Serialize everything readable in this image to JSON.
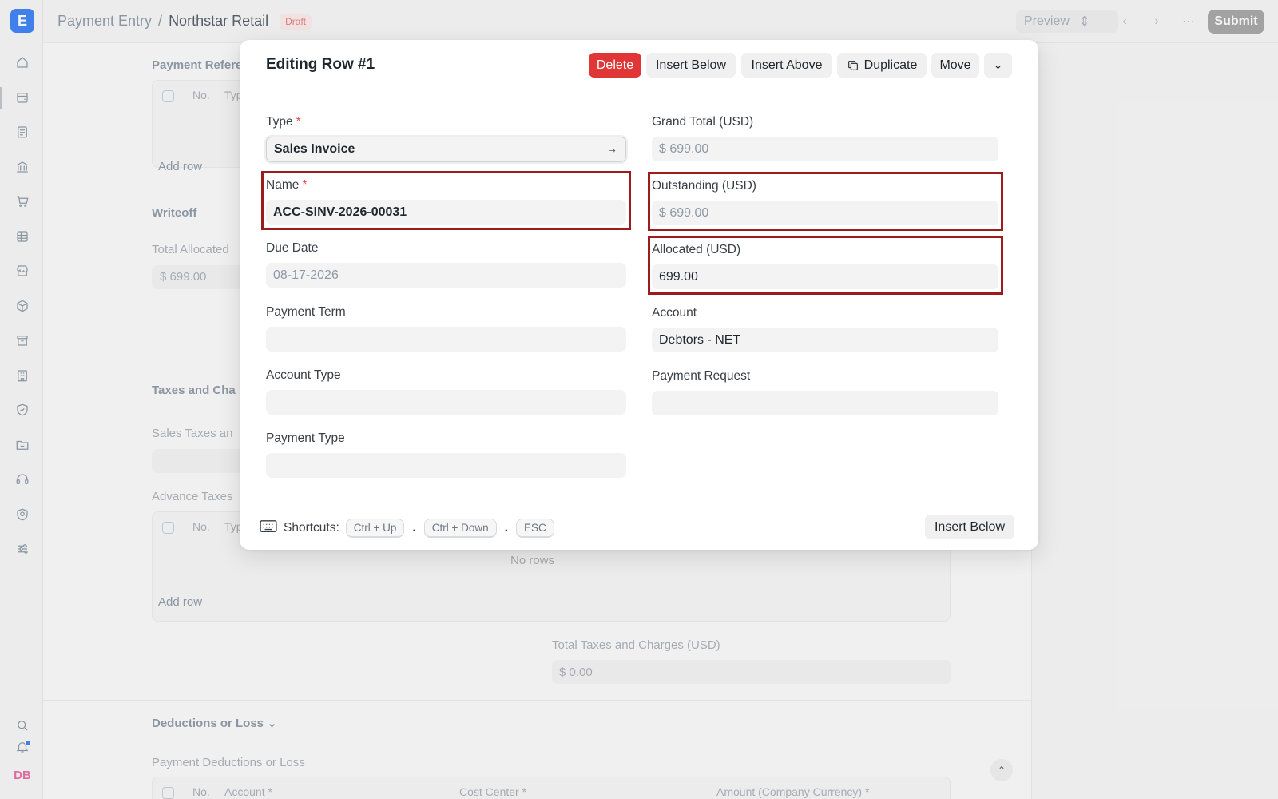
{
  "app": {
    "logo_letter": "E"
  },
  "breadcrumb": {
    "parent": "Payment Entry",
    "separator": "/",
    "current": "Northstar Retail",
    "status": "Draft"
  },
  "topbar": {
    "preview_label": "Preview",
    "submit_label": "Submit"
  },
  "sidebar": {
    "avatar_initials": "DB"
  },
  "background": {
    "payment_references_label": "Payment Refere",
    "table_no": "No.",
    "table_type": "Typ",
    "add_row": "Add row",
    "writeoff_label": "Writeoff",
    "total_allocated_label": "Total Allocated",
    "total_allocated_value": "$ 699.00",
    "taxes_label": "Taxes and Cha",
    "sales_taxes_label": "Sales Taxes an",
    "advance_taxes_label": "Advance Taxes",
    "no_rows": "No rows",
    "add_row_2": "Add row",
    "total_taxes_label": "Total Taxes and Charges (USD)",
    "total_taxes_value": "$ 0.00",
    "deductions_label": "Deductions or Loss",
    "payment_deductions_label": "Payment Deductions or Loss",
    "ded_no": "No.",
    "ded_account": "Account *",
    "ded_cost_center": "Cost Center *",
    "ded_amount": "Amount (Company Currency) *"
  },
  "modal": {
    "title": "Editing Row #1",
    "actions": {
      "delete": "Delete",
      "insert_below": "Insert Below",
      "insert_above": "Insert Above",
      "duplicate": "Duplicate",
      "move": "Move"
    },
    "fields": {
      "type": {
        "label": "Type",
        "value": "Sales Invoice"
      },
      "name": {
        "label": "Name",
        "value": "ACC-SINV-2026-00031"
      },
      "due_date": {
        "label": "Due Date",
        "value": "08-17-2026"
      },
      "payment_term": {
        "label": "Payment Term",
        "value": ""
      },
      "account_type": {
        "label": "Account Type",
        "value": ""
      },
      "payment_type": {
        "label": "Payment Type",
        "value": ""
      },
      "grand_total": {
        "label": "Grand Total (USD)",
        "value": "$ 699.00"
      },
      "outstanding": {
        "label": "Outstanding (USD)",
        "value": "$ 699.00"
      },
      "allocated": {
        "label": "Allocated (USD)",
        "value": "699.00"
      },
      "account": {
        "label": "Account",
        "value": "Debtors - NET"
      },
      "payment_request": {
        "label": "Payment Request",
        "value": ""
      }
    },
    "required_marker": "*",
    "shortcuts": {
      "label": "Shortcuts:",
      "keys": [
        "Ctrl + Up",
        "Ctrl + Down",
        "ESC"
      ],
      "separator": "."
    },
    "footer_button": "Insert Below"
  }
}
